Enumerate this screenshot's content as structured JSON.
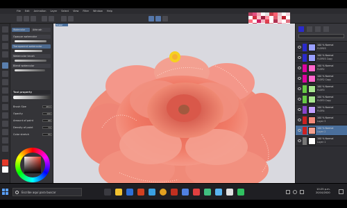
{
  "menu": {
    "items": [
      "File",
      "Edit",
      "Animation",
      "Layer",
      "Select",
      "View",
      "Filter",
      "Window",
      "Help"
    ]
  },
  "canvas_tab": {
    "label": "flower"
  },
  "subtool_panel": {
    "active_group": "Watercolor",
    "group_tab_2": "Airbrush",
    "subtools": [
      "Opaque watercolor",
      "Transparent watercolor",
      "Watercolor brush",
      "Blend watercolor"
    ],
    "active_subtool": "Transparent watercolor"
  },
  "tool_property": {
    "title": "Tool property",
    "brush_size_label": "Brush Size",
    "brush_size_value": "28.0",
    "opacity_label": "Opacity",
    "opacity_value": "100",
    "amount_label": "Amount of paint",
    "amount_value": "68",
    "density_label": "Density of paint",
    "density_value": "74",
    "blend_label": "Color stretch",
    "blend_value": "55"
  },
  "layers": [
    {
      "name": "100 % Normal",
      "sub": "FLORES",
      "color": "#2a2acc",
      "thumb": "#9aa0ff"
    },
    {
      "name": "100 % Normal",
      "sub": "FLORES Copy",
      "color": "#2a2acc",
      "thumb": "#9aa0ff"
    },
    {
      "name": "100 % Normal",
      "sub": "FLOR2",
      "color": "#e000a0",
      "thumb": "#ff66cc"
    },
    {
      "name": "100 % Normal",
      "sub": "FLOR2 Copy",
      "color": "#e000a0",
      "thumb": "#ff66cc"
    },
    {
      "name": "100 % Normal",
      "sub": "FLOR3",
      "color": "#66cc44",
      "thumb": "#a8e690"
    },
    {
      "name": "100 % Normal",
      "sub": "FLOR3 Copy",
      "color": "#66cc44",
      "thumb": "#a8e690"
    },
    {
      "name": "100 % Normal",
      "sub": "FLOR4",
      "color": "#8844cc",
      "thumb": "#c3a0ff"
    },
    {
      "name": "100 % Normal",
      "sub": "Layer 3",
      "color": "#cc2222",
      "thumb": "#f28a7a"
    },
    {
      "name": "100 % Normal",
      "sub": "Layer 2",
      "color": "#cc2222",
      "thumb": "#f2a090",
      "selected": true
    },
    {
      "name": "100 % Normal",
      "sub": "Layer 1",
      "color": "#777777",
      "thumb": "#ffffff"
    }
  ],
  "taskbar": {
    "search_placeholder": "Escribe aquí para buscar",
    "time": "10:25 p.m.",
    "date": "20/10/2020"
  },
  "colors": {
    "accent": "#4a6f9c",
    "canvas_bg": "#d9d9df",
    "petal": "#f07a66",
    "petal_light": "#ffb6a6",
    "pistil": "#f5d020"
  }
}
